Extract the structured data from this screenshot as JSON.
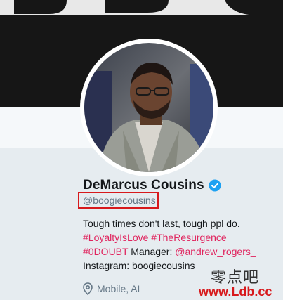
{
  "profile": {
    "display_name": "DeMarcus Cousins",
    "handle": "@boogiecousins",
    "verified": true,
    "bio": {
      "line1": "Tough times don't last, tough ppl do.",
      "hashtag1": "#LoyaltyIsLove",
      "hashtag2": "#TheResurgence",
      "hashtag3": "#0DOUBT",
      "manager_label": "Manager:",
      "manager_mention": "@andrew_rogers_",
      "instagram": "Instagram: boogiecousins"
    },
    "location": "Mobile, AL"
  },
  "watermark": {
    "chinese": "零点吧",
    "url": "www.Ldb.cc"
  },
  "colors": {
    "link": "#e0245e",
    "verified": "#1da1f2",
    "highlight_box": "#d7191c",
    "muted": "#657786"
  },
  "icons": {
    "verified": "verified-badge-icon",
    "location": "location-pin-icon"
  }
}
